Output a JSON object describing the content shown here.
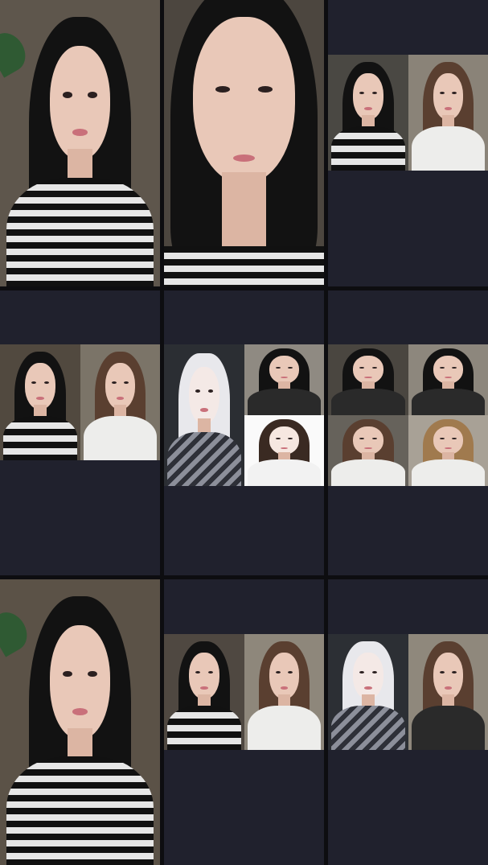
{
  "screen": {
    "background": "#0d0d10",
    "cell_background": "#20212d"
  },
  "tiles": [
    {
      "name": "tile-1-host-striped-top",
      "participants": 1
    },
    {
      "name": "tile-2-host-closeup",
      "participants": 1
    },
    {
      "name": "tile-3-two-guests",
      "participants": 2
    },
    {
      "name": "tile-4-two-guests",
      "participants": 2
    },
    {
      "name": "tile-5-three-guests-anime",
      "participants": 3
    },
    {
      "name": "tile-6-four-guests",
      "participants": 4
    },
    {
      "name": "tile-7-host-striped-top",
      "participants": 1
    },
    {
      "name": "tile-8-two-guests",
      "participants": 2
    },
    {
      "name": "tile-9-two-guests-anime",
      "participants": 2
    }
  ],
  "colors": {
    "skin": "#e9c8b8",
    "hair_dark": "#121212",
    "stripe_dark": "#111111",
    "stripe_light": "#e6e6e6",
    "room_wall": "#5b5247"
  }
}
